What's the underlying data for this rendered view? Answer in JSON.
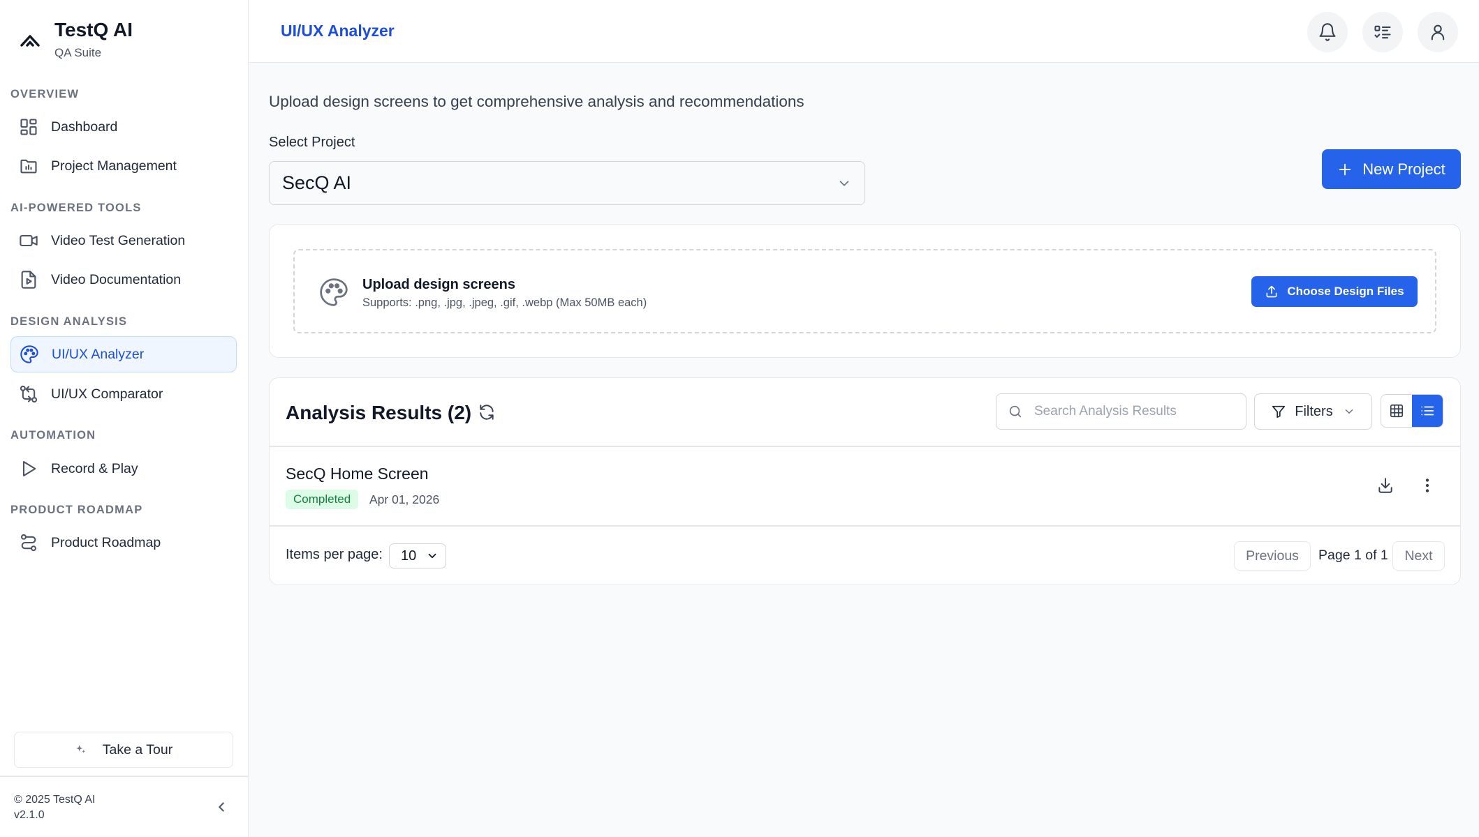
{
  "brand": {
    "title": "TestQ AI",
    "subtitle": "QA Suite"
  },
  "sidebar": {
    "sections": [
      {
        "label": "OVERVIEW",
        "items": [
          {
            "label": "Dashboard",
            "icon": "dashboard-icon"
          },
          {
            "label": "Project Management",
            "icon": "folder-chart-icon"
          }
        ]
      },
      {
        "label": "AI-POWERED TOOLS",
        "items": [
          {
            "label": "Video Test Generation",
            "icon": "video-icon"
          },
          {
            "label": "Video Documentation",
            "icon": "file-play-icon"
          }
        ]
      },
      {
        "label": "DESIGN ANALYSIS",
        "items": [
          {
            "label": "UI/UX Analyzer",
            "icon": "palette-icon",
            "active": true
          },
          {
            "label": "UI/UX Comparator",
            "icon": "git-compare-icon"
          }
        ]
      },
      {
        "label": "AUTOMATION",
        "items": [
          {
            "label": "Record & Play",
            "icon": "play-icon"
          }
        ]
      },
      {
        "label": "PRODUCT ROADMAP",
        "items": [
          {
            "label": "Product Roadmap",
            "icon": "route-icon"
          }
        ]
      }
    ],
    "tour_label": "Take a Tour",
    "copyright": "© 2025 TestQ AI",
    "version": "v2.1.0"
  },
  "header": {
    "title": "UI/UX Analyzer"
  },
  "main": {
    "intro": "Upload design screens to get comprehensive analysis and recommendations",
    "select_label": "Select Project",
    "selected_project": "SecQ AI",
    "new_project_label": "New Project",
    "upload": {
      "title": "Upload design screens",
      "subtitle": "Supports: .png, .jpg, .jpeg, .gif, .webp (Max 50MB each)",
      "button_label": "Choose Design Files"
    },
    "results": {
      "title": "Analysis Results (2)",
      "search_placeholder": "Search Analysis Results",
      "filters_label": "Filters",
      "view_mode": "list",
      "rows": [
        {
          "name": "SecQ Home Screen",
          "status": "Completed",
          "date": "Apr 01, 2026"
        }
      ],
      "items_per_page_label": "Items per page:",
      "items_per_page": "10",
      "previous_label": "Previous",
      "page_info": "Page 1 of 1",
      "next_label": "Next"
    }
  },
  "colors": {
    "accent": "#2563eb",
    "active_bg": "#eff6ff",
    "success_bg": "#dcfce7",
    "success_text": "#15803d"
  }
}
